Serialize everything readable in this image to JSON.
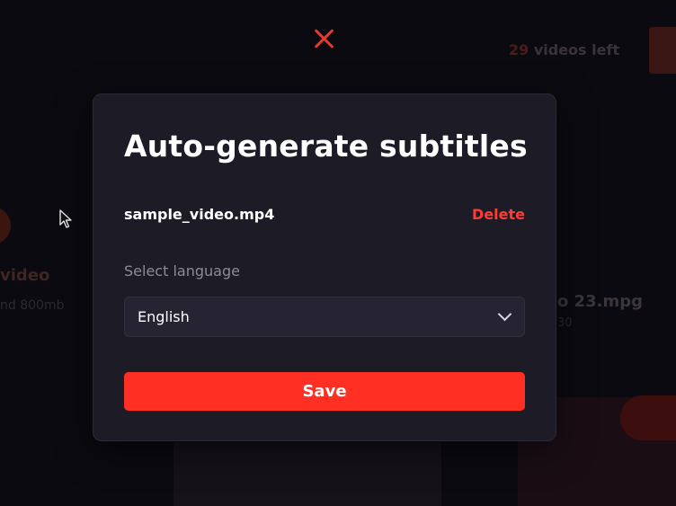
{
  "background": {
    "videos_left_count": "29",
    "videos_left_text": " videos left",
    "left_card_title": "video",
    "left_card_sub": "nd 800mb",
    "right_card_title": "o 23.mpg",
    "right_card_sub": "30"
  },
  "modal": {
    "title": "Auto-generate subtitles",
    "file_name": "sample_video.mp4",
    "delete_label": "Delete",
    "language_label": "Select language",
    "language_selected": "English",
    "save_label": "Save"
  },
  "colors": {
    "accent": "#ff2f24",
    "modal_bg": "#1d1b26",
    "page_bg": "#0b0a10"
  },
  "icons": {
    "close": "close-icon",
    "dropdown": "chevron-down-icon",
    "cursor": "mouse-cursor-icon"
  }
}
